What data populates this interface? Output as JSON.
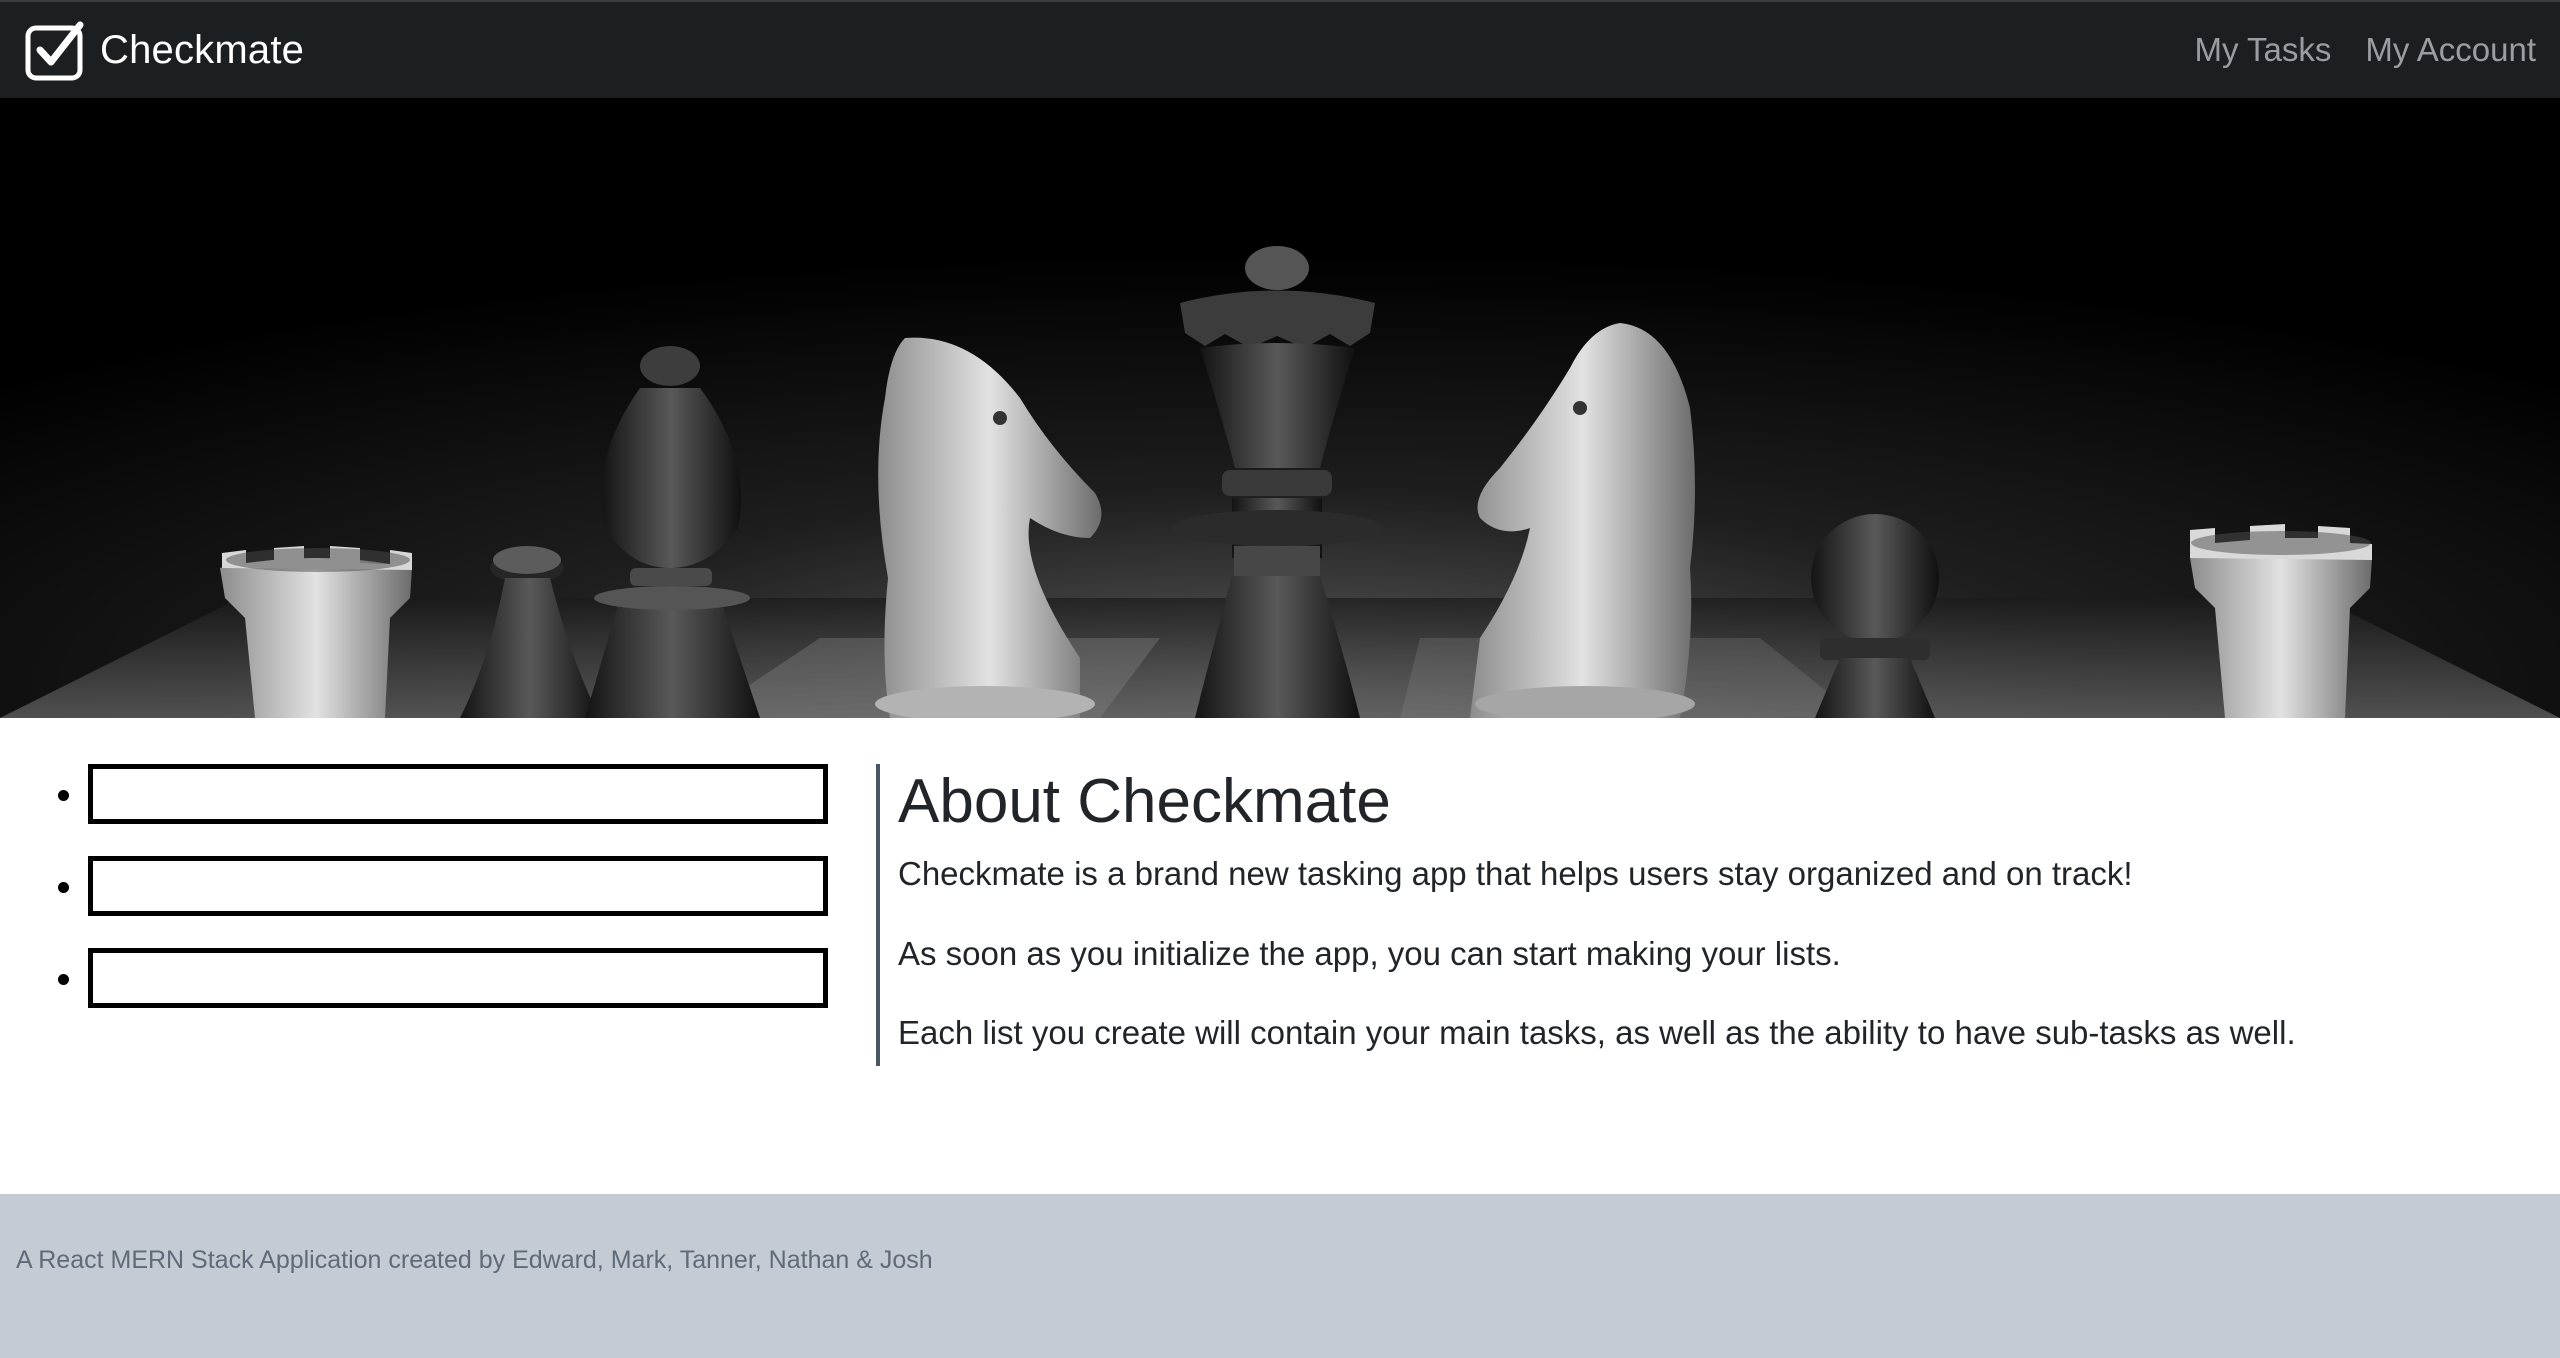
{
  "navbar": {
    "brand": "Checkmate",
    "links": [
      {
        "label": "My Tasks"
      },
      {
        "label": "My Account"
      }
    ]
  },
  "hero": {
    "image": "chess-pieces-photo"
  },
  "task_list": {
    "items": [
      {
        "value": ""
      },
      {
        "value": ""
      },
      {
        "value": ""
      }
    ]
  },
  "about": {
    "title": "About Checkmate",
    "paragraphs": [
      "Checkmate is a brand new tasking app that helps users stay organized and on track!",
      "As soon as you initialize the app, you can start making your lists.",
      "Each list you create will contain your main tasks, as well as the ability to have sub-tasks as well."
    ]
  },
  "footer": {
    "credit": "A React MERN Stack Application created by Edward, Mark, Tanner, Nathan & Josh"
  },
  "colors": {
    "navbar_bg": "#1c1f22",
    "footer_bg": "#c4cbd3",
    "about_border": "#4a5664"
  }
}
